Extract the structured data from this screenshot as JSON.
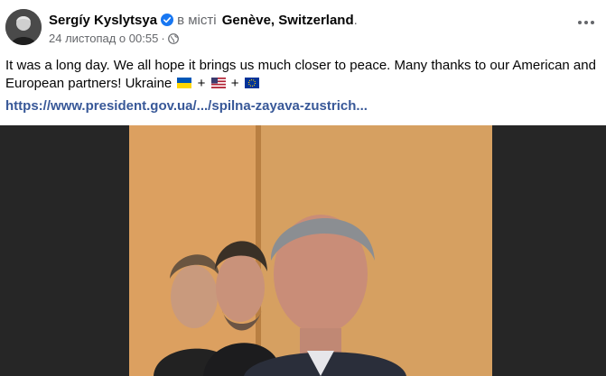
{
  "post": {
    "author": "Sergíy Kyslytsya",
    "location_prefix": "в місті",
    "location": "Genève, Switzerland",
    "location_suffix": ".",
    "date": "24 листопад о 00:55",
    "separator": "·",
    "text_main": "It was a long day. We all hope it brings us much closer to peace. Many thanks to our American and European partners! Ukraine",
    "plus": "+",
    "link": "https://www.president.gov.ua/.../spilna-zayava-zustrich..."
  },
  "icons": {
    "avatar": "avatar",
    "verified": "verified-badge-icon",
    "privacy": "globe-icon",
    "more": "more-options-icon",
    "flag_ua": "ukraine-flag-icon",
    "flag_us": "usa-flag-icon",
    "flag_eu": "eu-flag-icon"
  },
  "colors": {
    "link": "#385898",
    "secondary_text": "#65676b",
    "verified": "#1877f2",
    "media_background": "#262626"
  }
}
